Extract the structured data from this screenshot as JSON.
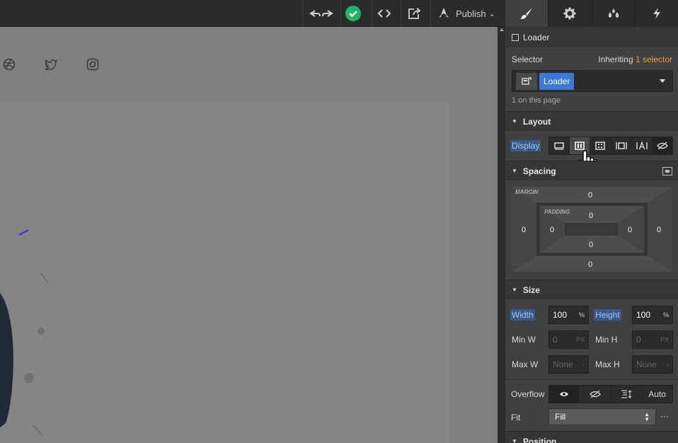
{
  "toolbar": {
    "undo_redo_icon": "undo-redo-icon",
    "status_icon": "check-circle-icon",
    "status_color": "#20b563",
    "code_icon": "code-icon",
    "export_icon": "export-icon",
    "publish_label": "Publish",
    "publish_caret": "⌄"
  },
  "canvas": {
    "social_icons": [
      "dribbble-icon",
      "twitter-icon",
      "instagram-icon"
    ],
    "accent_color": "#3b3bbd"
  },
  "panel": {
    "tabs": [
      {
        "name": "style",
        "icon": "brush-icon",
        "active": true
      },
      {
        "name": "settings",
        "icon": "gear-icon",
        "active": false
      },
      {
        "name": "interactions-colors",
        "icon": "drops-icon",
        "active": false
      },
      {
        "name": "interactions",
        "icon": "lightning-icon",
        "active": false
      }
    ],
    "element_name": "Loader",
    "selector": {
      "label": "Selector",
      "inheriting_prefix": "Inheriting",
      "inheriting_link": "1 selector",
      "inheriting_color": "#f09a3e",
      "tag": "Loader",
      "tag_color": "#3c78d8",
      "on_page": "1 on this page"
    },
    "layout": {
      "title": "Layout",
      "display_label": "Display",
      "display_options": [
        "block-icon",
        "flex-icon",
        "grid-icon",
        "inline-block-icon",
        "inline-icon",
        "none-icon"
      ],
      "selected_option": "flex-icon"
    },
    "spacing": {
      "title": "Spacing",
      "margin_label": "MARGIN",
      "padding_label": "PADDING",
      "margin": {
        "top": "0",
        "right": "0",
        "bottom": "0",
        "left": "0"
      },
      "padding": {
        "top": "0",
        "right": "0",
        "bottom": "0",
        "left": "0"
      }
    },
    "size": {
      "title": "Size",
      "width_label": "Width",
      "width_value": "100",
      "width_unit": "%",
      "height_label": "Height",
      "height_value": "100",
      "height_unit": "%",
      "minw_label": "Min W",
      "minw_value": "0",
      "minw_unit": "PX",
      "minh_label": "Min H",
      "minh_value": "0",
      "minh_unit": "PX",
      "maxw_label": "Max W",
      "maxw_value": "None",
      "maxw_unit": "-",
      "maxh_label": "Max H",
      "maxh_value": "None",
      "maxh_unit": "-",
      "overflow_label": "Overflow",
      "overflow_options": [
        "visible-icon",
        "hidden-icon",
        "scroll-icon",
        "Auto"
      ],
      "fit_label": "Fit",
      "fit_value": "Fill",
      "more": "···"
    },
    "position": {
      "title": "Position"
    }
  }
}
